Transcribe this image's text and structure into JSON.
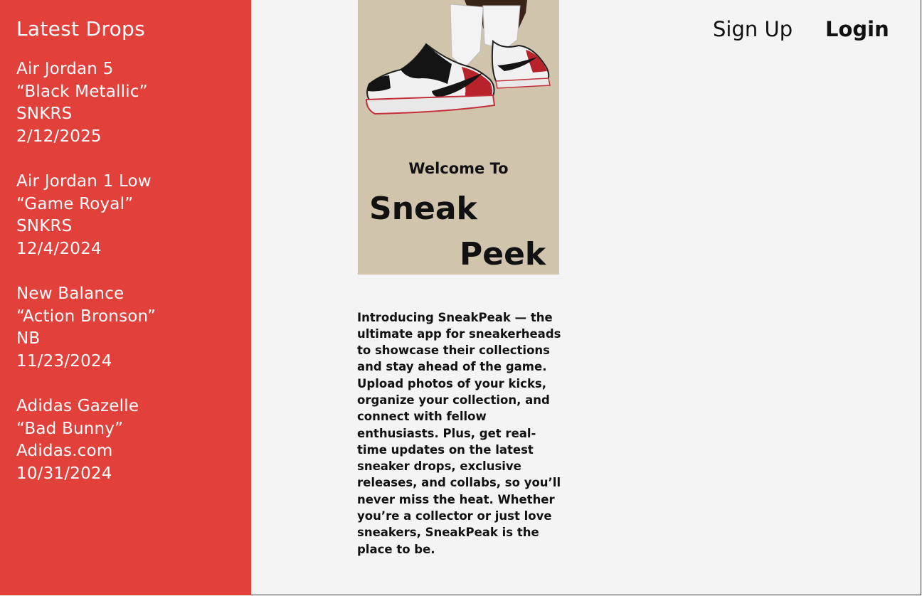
{
  "sidebar": {
    "title": "Latest Drops",
    "drops": [
      {
        "name": "Air Jordan 5",
        "colorway": "“Black Metallic”",
        "retailer": "SNKRS",
        "date": "2/12/2025"
      },
      {
        "name": "Air Jordan 1 Low",
        "colorway": "“Game Royal”",
        "retailer": "SNKRS",
        "date": "12/4/2024"
      },
      {
        "name": "New Balance",
        "colorway": "“Action Bronson”",
        "retailer": "NB",
        "date": "11/23/2024"
      },
      {
        "name": "Adidas Gazelle",
        "colorway": "“Bad Bunny”",
        "retailer": "Adidas.com",
        "date": "10/31/2024"
      }
    ]
  },
  "hero": {
    "welcome": "Welcome To",
    "brand_line1": "Sneak",
    "brand_line2": "Peek"
  },
  "intro": {
    "text": "Introducing SneakPeak — the ultimate app for sneakerheads to showcase their collections and stay ahead of the game. Upload photos of your kicks, organize your collection, and connect with fellow enthusiasts. Plus, get real-time updates on the latest sneaker drops, exclusive releases, and collabs, so you’ll never miss the heat. Whether you’re a collector or just love sneakers, SneakPeak is the place to be."
  },
  "header": {
    "signup_label": "Sign Up",
    "login_label": "Login"
  },
  "colors": {
    "sidebar_bg": "#e2403a",
    "page_bg": "#f4f4f4",
    "hero_bg": "#d0c4ac",
    "shoe_red": "#b8222a",
    "shoe_black": "#141414"
  },
  "icons": {
    "hero_image": "sneaker-illustration"
  }
}
